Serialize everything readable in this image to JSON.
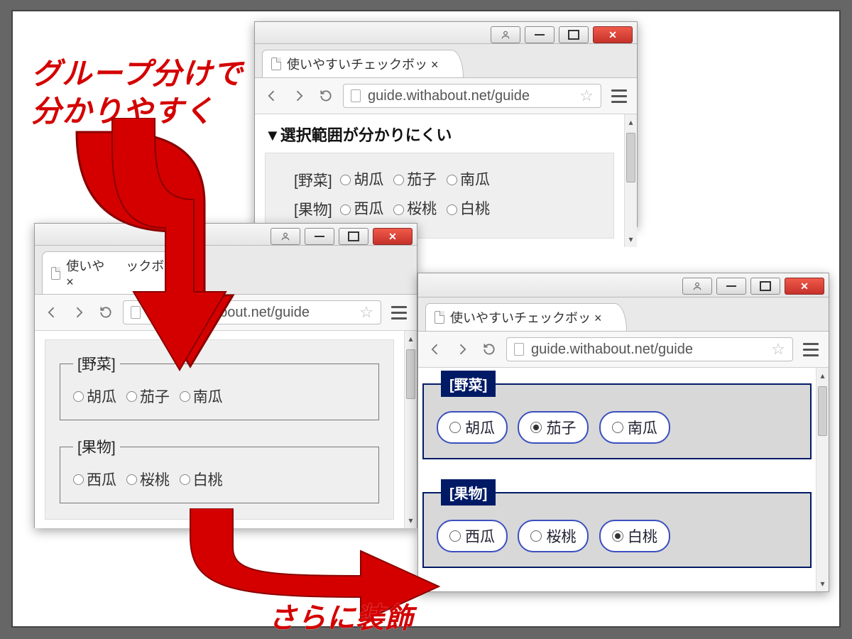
{
  "annotations": {
    "group_clearly": "グループ分けで\n分かりやすく",
    "further_style": "さらに装飾"
  },
  "shared": {
    "tab_title": "使いやすいチェックボッ",
    "url": "guide.withabout.net/guide"
  },
  "windowA": {
    "heading": "▼選択範囲が分かりにくい",
    "groups": {
      "veg_label": "[野菜]",
      "veg_opts": [
        "胡瓜",
        "茄子",
        "南瓜"
      ],
      "fruit_label": "[果物]",
      "fruit_opts": [
        "西瓜",
        "桜桃",
        "白桃"
      ]
    }
  },
  "windowB": {
    "veg_legend": "[野菜]",
    "veg_opts": [
      "胡瓜",
      "茄子",
      "南瓜"
    ],
    "fruit_legend": "[果物]",
    "fruit_opts": [
      "西瓜",
      "桜桃",
      "白桃"
    ]
  },
  "windowC": {
    "veg_legend": "[野菜]",
    "veg_opts": [
      "胡瓜",
      "茄子",
      "南瓜"
    ],
    "veg_selected": 1,
    "fruit_legend": "[果物]",
    "fruit_opts": [
      "西瓜",
      "桜桃",
      "白桃"
    ],
    "fruit_selected": 2
  }
}
